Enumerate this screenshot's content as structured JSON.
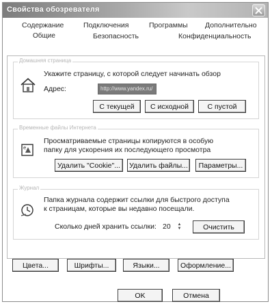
{
  "window": {
    "title": "Свойства обозревателя"
  },
  "tabs": {
    "row1": [
      "Содержание",
      "Подключения",
      "Программы",
      "Дополнительно"
    ],
    "row2": [
      "Общие",
      "Безопасность",
      "Конфиденциальность"
    ],
    "active": "Общие"
  },
  "home_page": {
    "legend": "Домашняя страница",
    "description": "Укажите страницу, с которой следует начинать обзор",
    "address_label": "Адрес:",
    "address_value": "http://www.yandex.ru/",
    "buttons": {
      "current": "С текущей",
      "default": "С исходной",
      "blank": "С пустой"
    }
  },
  "temp_files": {
    "legend": "Временные файлы Интернета",
    "description_line1": "Просматриваемые страницы копируются в особую",
    "description_line2": "папку для ускорения их последующего просмотра",
    "buttons": {
      "delete_cookies": "Удалить \"Cookie\"...",
      "delete_files": "Удалить файлы...",
      "settings": "Параметры..."
    }
  },
  "history": {
    "legend": "Журнал",
    "description_line1": "Папка журнала содержит ссылки для быстрого доступа",
    "description_line2": "к страницам, которые вы недавно посещали.",
    "days_label": "Сколько дней хранить ссылки:",
    "days_value": "20",
    "clear_button": "Очистить"
  },
  "bottom_buttons": {
    "colors": "Цвета...",
    "fonts": "Шрифты...",
    "languages": "Языки...",
    "accessibility": "Оформление..."
  },
  "footer": {
    "ok": "OK",
    "cancel": "Отмена"
  }
}
